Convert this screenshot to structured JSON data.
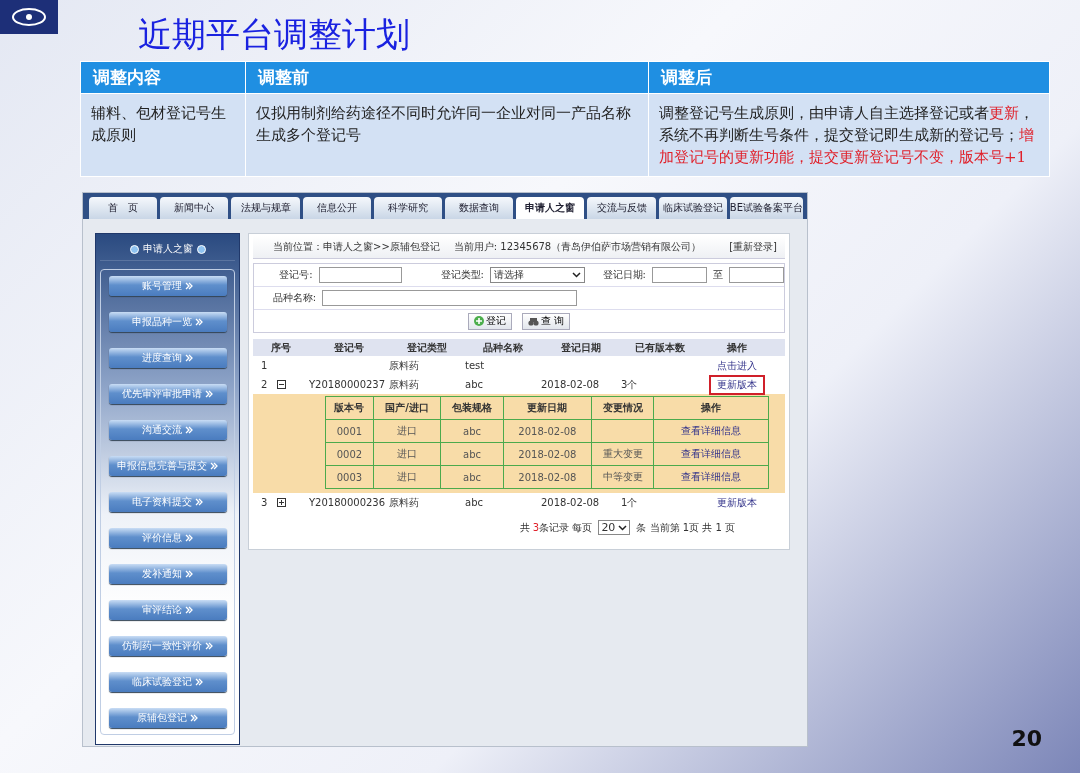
{
  "slide": {
    "title": "近期平台调整计划",
    "page_number": "20",
    "table": {
      "columns": [
        "调整内容",
        "调整前",
        "调整后"
      ],
      "rows": [
        [
          [
            {
              "text": "辅料、包材登记号生成原则",
              "highlight": false
            }
          ],
          [
            {
              "text": "仅拟用制剂给药途径不同时允许同一企业对同一产品名称生成多个登记号",
              "highlight": false
            }
          ],
          [
            {
              "text": "调整登记号生成原则，由申请人自主选择登记或者",
              "highlight": false
            },
            {
              "text": "更新",
              "highlight": true
            },
            {
              "text": "，系统不再判断生号条件，提交登记即生成新的登记号；",
              "highlight": false
            },
            {
              "text": "增加登记号的更新功能，提交更新登记号不变，版本号+1",
              "highlight": true
            }
          ]
        ]
      ]
    }
  },
  "screenshot": {
    "tabs": [
      {
        "label": "首　页",
        "selected": false
      },
      {
        "label": "新闻中心",
        "selected": false
      },
      {
        "label": "法规与规章",
        "selected": false
      },
      {
        "label": "信息公开",
        "selected": false
      },
      {
        "label": "科学研究",
        "selected": false
      },
      {
        "label": "数据查询",
        "selected": false
      },
      {
        "label": "申请人之窗",
        "selected": true
      },
      {
        "label": "交流与反馈",
        "selected": false
      },
      {
        "label": "临床试验登记",
        "selected": false
      },
      {
        "label": "BE试验备案平台",
        "selected": false
      }
    ],
    "sidebar": {
      "title": "申请人之窗",
      "items": [
        "账号管理",
        "申报品种一览",
        "进度查询",
        "优先审评审批申请",
        "沟通交流",
        "申报信息完善与提交",
        "电子资料提交",
        "评价信息",
        "发补通知",
        "审评结论",
        "仿制药一致性评价",
        "临床试验登记",
        "原辅包登记"
      ]
    },
    "header": {
      "location": "当前位置：申请人之窗>>原辅包登记",
      "user": "当前用户: 12345678（青岛伊伯萨市场营销有限公司）",
      "relogin": "[重新登录]"
    },
    "form": {
      "reg_no_label": "登记号:",
      "type_label": "登记类型:",
      "type_value": "请选择",
      "date_label": "登记日期:",
      "date_to": "至",
      "name_label": "品种名称:",
      "register_button": "登记",
      "query_button": "查 询"
    },
    "table": {
      "columns": [
        "序号",
        "登记号",
        "登记类型",
        "品种名称",
        "登记日期",
        "已有版本数",
        "操作"
      ],
      "rows": [
        {
          "seq": "1",
          "reg_no": "",
          "type": "原料药",
          "name": "test",
          "date": "",
          "versions": "",
          "action": "点击进入",
          "highlighted": false
        },
        {
          "seq": "2",
          "expanded": true,
          "reg_no": "Y20180000237",
          "type": "原料药",
          "name": "abc",
          "date": "2018-02-08",
          "versions": "3个",
          "action": "更新版本",
          "highlighted": true,
          "children": {
            "columns": [
              "版本号",
              "国产/进口",
              "包装规格",
              "更新日期",
              "变更情况",
              "操作"
            ],
            "rows": [
              [
                "0001",
                "进口",
                "abc",
                "2018-02-08",
                "",
                "查看详细信息"
              ],
              [
                "0002",
                "进口",
                "abc",
                "2018-02-08",
                "重大变更",
                "查看详细信息"
              ],
              [
                "0003",
                "进口",
                "abc",
                "2018-02-08",
                "中等变更",
                "查看详细信息"
              ]
            ]
          }
        },
        {
          "seq": "3",
          "expanded": false,
          "reg_no": "Y20180000236",
          "type": "原料药",
          "name": "abc",
          "date": "2018-02-08",
          "versions": "1个",
          "action": "更新版本",
          "highlighted": false
        }
      ]
    },
    "pagination": {
      "before": "共 ",
      "count": "3",
      "after": "条记录 每页",
      "page_size": "20",
      "info": "条 当前第 1页 共  1 页"
    }
  }
}
